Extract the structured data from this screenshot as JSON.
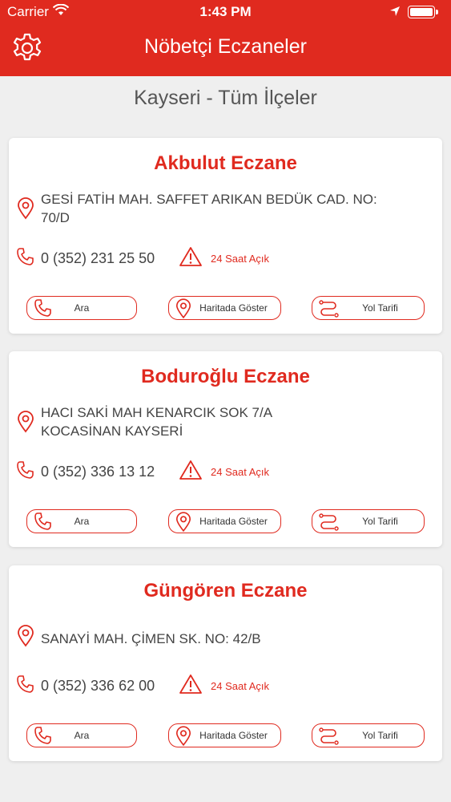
{
  "status_bar": {
    "carrier": "Carrier",
    "time": "1:43 PM"
  },
  "nav": {
    "title": "Nöbetçi Eczaneler"
  },
  "region": "Kayseri - Tüm İlçeler",
  "buttons": {
    "call": "Ara",
    "map": "Haritada Göster",
    "directions": "Yol Tarifi"
  },
  "pharmacies": [
    {
      "name": "Akbulut Eczane",
      "address_line1": "GESİ FATİH MAH. SAFFET ARIKAN BEDÜK CAD. NO:",
      "address_line2": "70/D",
      "phone": "0 (352) 231 25 50",
      "hours": "24 Saat Açık"
    },
    {
      "name": "Boduroğlu Eczane",
      "address_line1": "HACI SAKİ MAH KENARCIK SOK 7/A",
      "address_line2": "KOCASİNAN KAYSERİ",
      "phone": "0 (352) 336 13 12",
      "hours": "24 Saat Açık"
    },
    {
      "name": "Güngören Eczane",
      "address_line1": "SANAYİ MAH. ÇİMEN SK. NO: 42/B",
      "address_line2": "",
      "phone": "0 (352) 336 62 00",
      "hours": "24 Saat Açık"
    }
  ],
  "colors": {
    "accent": "#e02a1f",
    "background": "#efefef"
  }
}
